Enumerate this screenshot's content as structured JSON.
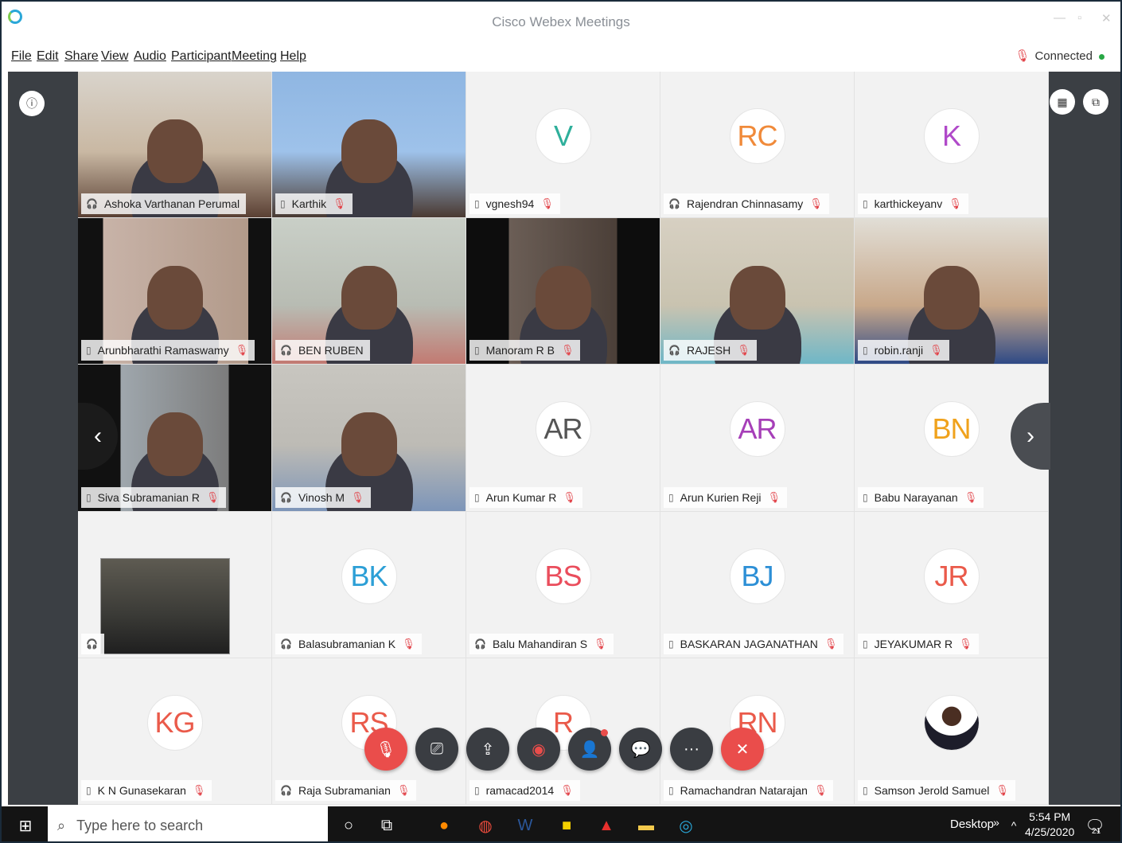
{
  "window": {
    "title": "Cisco Webex Meetings"
  },
  "menu": [
    "File",
    "Edit",
    "Share",
    "View",
    "Audio",
    "Participant",
    "Meeting",
    "Help"
  ],
  "status": {
    "connected_label": "Connected"
  },
  "tiles": [
    {
      "name": "Ashoka Varthanan  Perumal",
      "type": "video",
      "muted": false,
      "device": "headset"
    },
    {
      "name": "Karthik",
      "type": "video",
      "muted": true,
      "device": "phone"
    },
    {
      "name": "vgnesh94",
      "type": "avatar",
      "initials": "V",
      "color": "#2eaf9b",
      "muted": true,
      "device": "phone"
    },
    {
      "name": "Rajendran  Chinnasamy",
      "type": "avatar",
      "initials": "RC",
      "color": "#f08a3a",
      "muted": true,
      "device": "headset"
    },
    {
      "name": "karthickeyanv",
      "type": "avatar",
      "initials": "K",
      "color": "#b049c9",
      "muted": true,
      "device": "phone"
    },
    {
      "name": "Arunbharathi  Ramaswamy",
      "type": "video",
      "muted": true,
      "device": "phone"
    },
    {
      "name": "BEN RUBEN",
      "type": "video",
      "muted": false,
      "device": "headset"
    },
    {
      "name": "Manoram R B",
      "type": "video",
      "muted": true,
      "device": "phone"
    },
    {
      "name": "RAJESH",
      "type": "video",
      "muted": true,
      "device": "headset"
    },
    {
      "name": "robin.ranji",
      "type": "video",
      "muted": true,
      "device": "phone"
    },
    {
      "name": "Siva Subramanian R",
      "type": "video",
      "muted": true,
      "device": "phone"
    },
    {
      "name": "Vinosh M",
      "type": "video",
      "muted": true,
      "device": "headset"
    },
    {
      "name": "Arun Kumar R",
      "type": "avatar",
      "initials": "AR",
      "color": "#555555",
      "muted": true,
      "device": "phone"
    },
    {
      "name": "Arun Kurien  Reji",
      "type": "avatar",
      "initials": "AR",
      "color": "#a63fb8",
      "muted": true,
      "device": "phone"
    },
    {
      "name": "Babu Narayanan",
      "type": "avatar",
      "initials": "BN",
      "color": "#f0a21c",
      "muted": true,
      "device": "phone"
    },
    {
      "name": "",
      "type": "selfview",
      "muted": false,
      "device": "headset"
    },
    {
      "name": "Balasubramanian K",
      "type": "avatar",
      "initials": "BK",
      "color": "#2c9fd6",
      "muted": true,
      "device": "headset"
    },
    {
      "name": "Balu  Mahandiran S",
      "type": "avatar",
      "initials": "BS",
      "color": "#ea4d5c",
      "muted": true,
      "device": "headset"
    },
    {
      "name": "BASKARAN JAGANATHAN",
      "type": "avatar",
      "initials": "BJ",
      "color": "#2c8fd6",
      "muted": true,
      "device": "phone"
    },
    {
      "name": "JEYAKUMAR R",
      "type": "avatar",
      "initials": "JR",
      "color": "#ea5a4a",
      "muted": true,
      "device": "phone"
    },
    {
      "name": "K N Gunasekaran",
      "type": "avatar",
      "initials": "KG",
      "color": "#ea5a4a",
      "muted": true,
      "device": "phone"
    },
    {
      "name": "Raja Subramanian",
      "type": "avatar",
      "initials": "RS",
      "color": "#ea5a4a",
      "muted": true,
      "device": "headset"
    },
    {
      "name": "ramacad2014",
      "type": "avatar",
      "initials": "R",
      "color": "#ea5a4a",
      "muted": true,
      "device": "phone"
    },
    {
      "name": "Ramachandran  Natarajan",
      "type": "avatar",
      "initials": "RN",
      "color": "#ea5a4a",
      "muted": true,
      "device": "phone"
    },
    {
      "name": "Samson Jerold  Samuel",
      "type": "photo",
      "muted": true,
      "device": "phone"
    }
  ],
  "controls": [
    "mute-icon",
    "stop-video-icon",
    "share-icon",
    "record-icon",
    "participants-icon",
    "chat-icon",
    "more-icon",
    "leave-icon"
  ],
  "taskbar": {
    "search_placeholder": "Type here to search",
    "desktop_label": "Desktop",
    "time": "5:54 PM",
    "date": "4/25/2020",
    "notification_count": "21"
  }
}
